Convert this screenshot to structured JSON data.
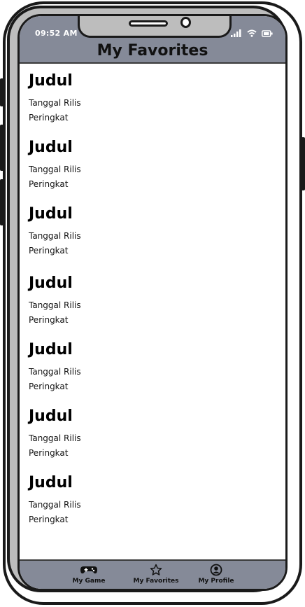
{
  "status": {
    "time": "09:52 AM"
  },
  "header": {
    "title": "My Favorites"
  },
  "favorites": [
    {
      "title": "Judul",
      "release_date_label": "Tanggal Rilis",
      "rating_label": "Peringkat"
    },
    {
      "title": "Judul",
      "release_date_label": "Tanggal Rilis",
      "rating_label": "Peringkat"
    },
    {
      "title": "Judul",
      "release_date_label": "Tanggal Rilis",
      "rating_label": "Peringkat"
    },
    {
      "title": "Judul",
      "release_date_label": "Tanggal Rilis",
      "rating_label": "Peringkat"
    },
    {
      "title": "Judul",
      "release_date_label": "Tanggal Rilis",
      "rating_label": "Peringkat"
    },
    {
      "title": "Judul",
      "release_date_label": "Tanggal Rilis",
      "rating_label": "Peringkat"
    },
    {
      "title": "Judul",
      "release_date_label": "Tanggal Rilis",
      "rating_label": "Peringkat"
    }
  ],
  "bottom_nav": {
    "items": [
      {
        "label": "My Game",
        "icon": "gamepad-icon"
      },
      {
        "label": "My Favorites",
        "icon": "star-icon"
      },
      {
        "label": "My Profile",
        "icon": "profile-icon"
      }
    ]
  },
  "colors": {
    "bar": "#858a98",
    "frame": "#bdbdbd",
    "outline": "#1a1a1a"
  }
}
